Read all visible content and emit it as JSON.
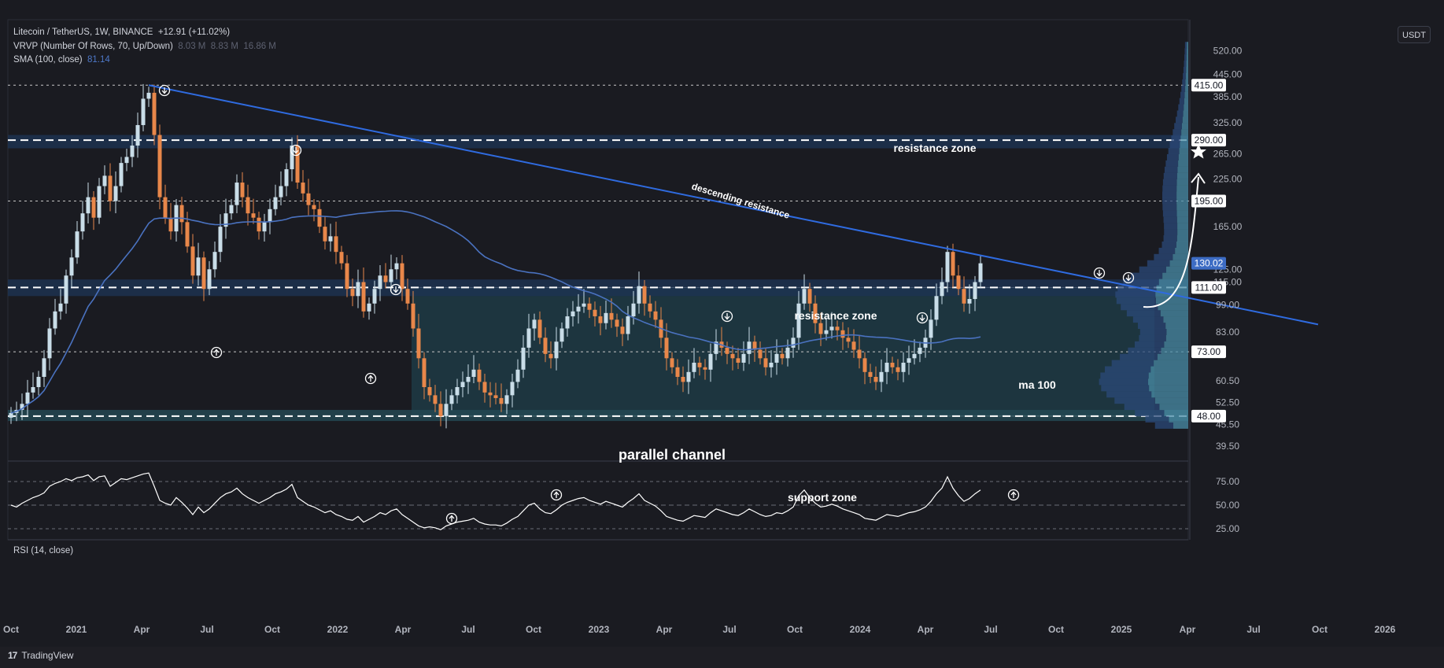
{
  "legend": {
    "symbol": "Litecoin / TetherUS, 1W, BINANCE",
    "change": "+12.91 (+11.02%)",
    "vrvp_label": "VRVP (Number Of Rows, 70, Up/Down)",
    "vrvp_v1": "8.03 M",
    "vrvp_v2": "8.83 M",
    "vrvp_v3": "16.86 M",
    "sma_label": "SMA (100, close)",
    "sma_value": "81.14"
  },
  "unit_button": "USDT",
  "rsi_label": "RSI (14, close)",
  "brand": "TradingView",
  "colors": {
    "background": "#1a1b21",
    "up_candle": "#c9dde8",
    "down_candle": "#e8874a",
    "trendline": "#2f6be0",
    "sma": "#4a72c0",
    "channel_fill": "#1f3a44",
    "zone_fill": "#1d3352",
    "rsi_line": "#ffffff"
  },
  "chart_data": {
    "type": "candlestick",
    "title": "Litecoin / TetherUS, 1W, BINANCE",
    "price_scale": "log",
    "ylim": [
      36,
      620
    ],
    "price_ticks": [
      "520.00",
      "445.00",
      "385.00",
      "325.00",
      "265.00",
      "225.00",
      "165.00",
      "125.00",
      "115.00",
      "99.00",
      "83.00",
      "60.50",
      "52.50",
      "45.50",
      "39.50"
    ],
    "price_tags": [
      {
        "value": 415.0,
        "label": "415.00",
        "style": "white"
      },
      {
        "value": 290.0,
        "label": "290.00",
        "style": "white"
      },
      {
        "value": 195.0,
        "label": "195.00",
        "style": "white"
      },
      {
        "value": 130.02,
        "label": "130.02",
        "style": "blue"
      },
      {
        "value": 111.0,
        "label": "111.00",
        "style": "white"
      },
      {
        "value": 73.0,
        "label": "73.00",
        "style": "white"
      },
      {
        "value": 48.0,
        "label": "48.00",
        "style": "white"
      }
    ],
    "time_ticks": [
      "Oct",
      "2021",
      "Apr",
      "Jul",
      "Oct",
      "2022",
      "Apr",
      "Jul",
      "Oct",
      "2023",
      "Apr",
      "Jul",
      "Oct",
      "2024",
      "Apr",
      "Jul",
      "Oct",
      "2025",
      "Apr",
      "Jul",
      "Oct",
      "2026"
    ],
    "weekly_close": [
      49,
      50,
      52,
      56,
      58,
      62,
      70,
      85,
      95,
      100,
      120,
      135,
      160,
      180,
      200,
      175,
      215,
      230,
      195,
      215,
      250,
      260,
      280,
      320,
      380,
      395,
      300,
      200,
      175,
      160,
      190,
      170,
      145,
      120,
      135,
      110,
      125,
      140,
      165,
      180,
      190,
      220,
      200,
      180,
      175,
      160,
      170,
      185,
      200,
      215,
      240,
      280,
      220,
      205,
      190,
      185,
      165,
      150,
      155,
      140,
      130,
      110,
      105,
      115,
      95,
      100,
      110,
      120,
      115,
      125,
      130,
      110,
      100,
      85,
      70,
      58,
      55,
      52,
      48,
      52,
      55,
      58,
      60,
      62,
      65,
      60,
      56,
      55,
      54,
      52,
      55,
      60,
      65,
      75,
      85,
      90,
      80,
      72,
      70,
      78,
      85,
      92,
      95,
      98,
      100,
      96,
      92,
      88,
      94,
      90,
      86,
      82,
      92,
      100,
      112,
      100,
      95,
      90,
      80,
      70,
      66,
      62,
      60,
      64,
      68,
      66,
      65,
      72,
      78,
      75,
      72,
      70,
      68,
      72,
      78,
      74,
      70,
      66,
      68,
      72,
      70,
      75,
      80,
      100,
      110,
      100,
      88,
      82,
      84,
      86,
      84,
      80,
      78,
      74,
      70,
      64,
      62,
      60,
      64,
      68,
      66,
      64,
      68,
      70,
      72,
      75,
      80,
      90,
      105,
      115,
      140,
      120,
      110,
      100,
      103,
      115,
      130
    ],
    "annotations": [
      {
        "text": "resistance zone",
        "where": "upper zone near 290"
      },
      {
        "text": "descending resistance",
        "where": "trendline from 415 high"
      },
      {
        "text": "resistance zone",
        "where": "zone near 111"
      },
      {
        "text": "ma 100",
        "where": "SMA label"
      },
      {
        "text": "parallel channel",
        "where": "channel 48 to 111"
      },
      {
        "text": "support zone",
        "where": "zone near 48"
      }
    ],
    "rsi": {
      "levels": [
        "75.00",
        "50.00",
        "25.00"
      ],
      "values": [
        50,
        48,
        52,
        55,
        58,
        60,
        63,
        70,
        73,
        75,
        78,
        76,
        79,
        80,
        82,
        76,
        80,
        81,
        70,
        74,
        78,
        77,
        79,
        81,
        83,
        84,
        70,
        55,
        52,
        50,
        58,
        53,
        47,
        40,
        48,
        42,
        46,
        52,
        58,
        62,
        64,
        68,
        62,
        58,
        55,
        52,
        55,
        58,
        62,
        64,
        67,
        72,
        58,
        54,
        50,
        48,
        45,
        42,
        44,
        40,
        38,
        35,
        34,
        38,
        32,
        35,
        38,
        42,
        40,
        44,
        46,
        40,
        36,
        32,
        28,
        26,
        27,
        26,
        24,
        28,
        30,
        32,
        33,
        34,
        36,
        32,
        30,
        29,
        29,
        28,
        31,
        35,
        38,
        44,
        50,
        52,
        46,
        42,
        41,
        45,
        50,
        53,
        55,
        57,
        58,
        55,
        53,
        51,
        54,
        52,
        50,
        48,
        53,
        57,
        62,
        55,
        52,
        49,
        44,
        38,
        36,
        34,
        33,
        36,
        39,
        38,
        37,
        42,
        46,
        44,
        42,
        40,
        39,
        42,
        46,
        43,
        40,
        38,
        39,
        42,
        41,
        44,
        48,
        60,
        66,
        58,
        52,
        48,
        49,
        51,
        49,
        46,
        44,
        42,
        40,
        36,
        35,
        34,
        37,
        40,
        39,
        38,
        40,
        42,
        43,
        45,
        48,
        54,
        62,
        68,
        80,
        68,
        60,
        54,
        57,
        62,
        66
      ]
    }
  }
}
